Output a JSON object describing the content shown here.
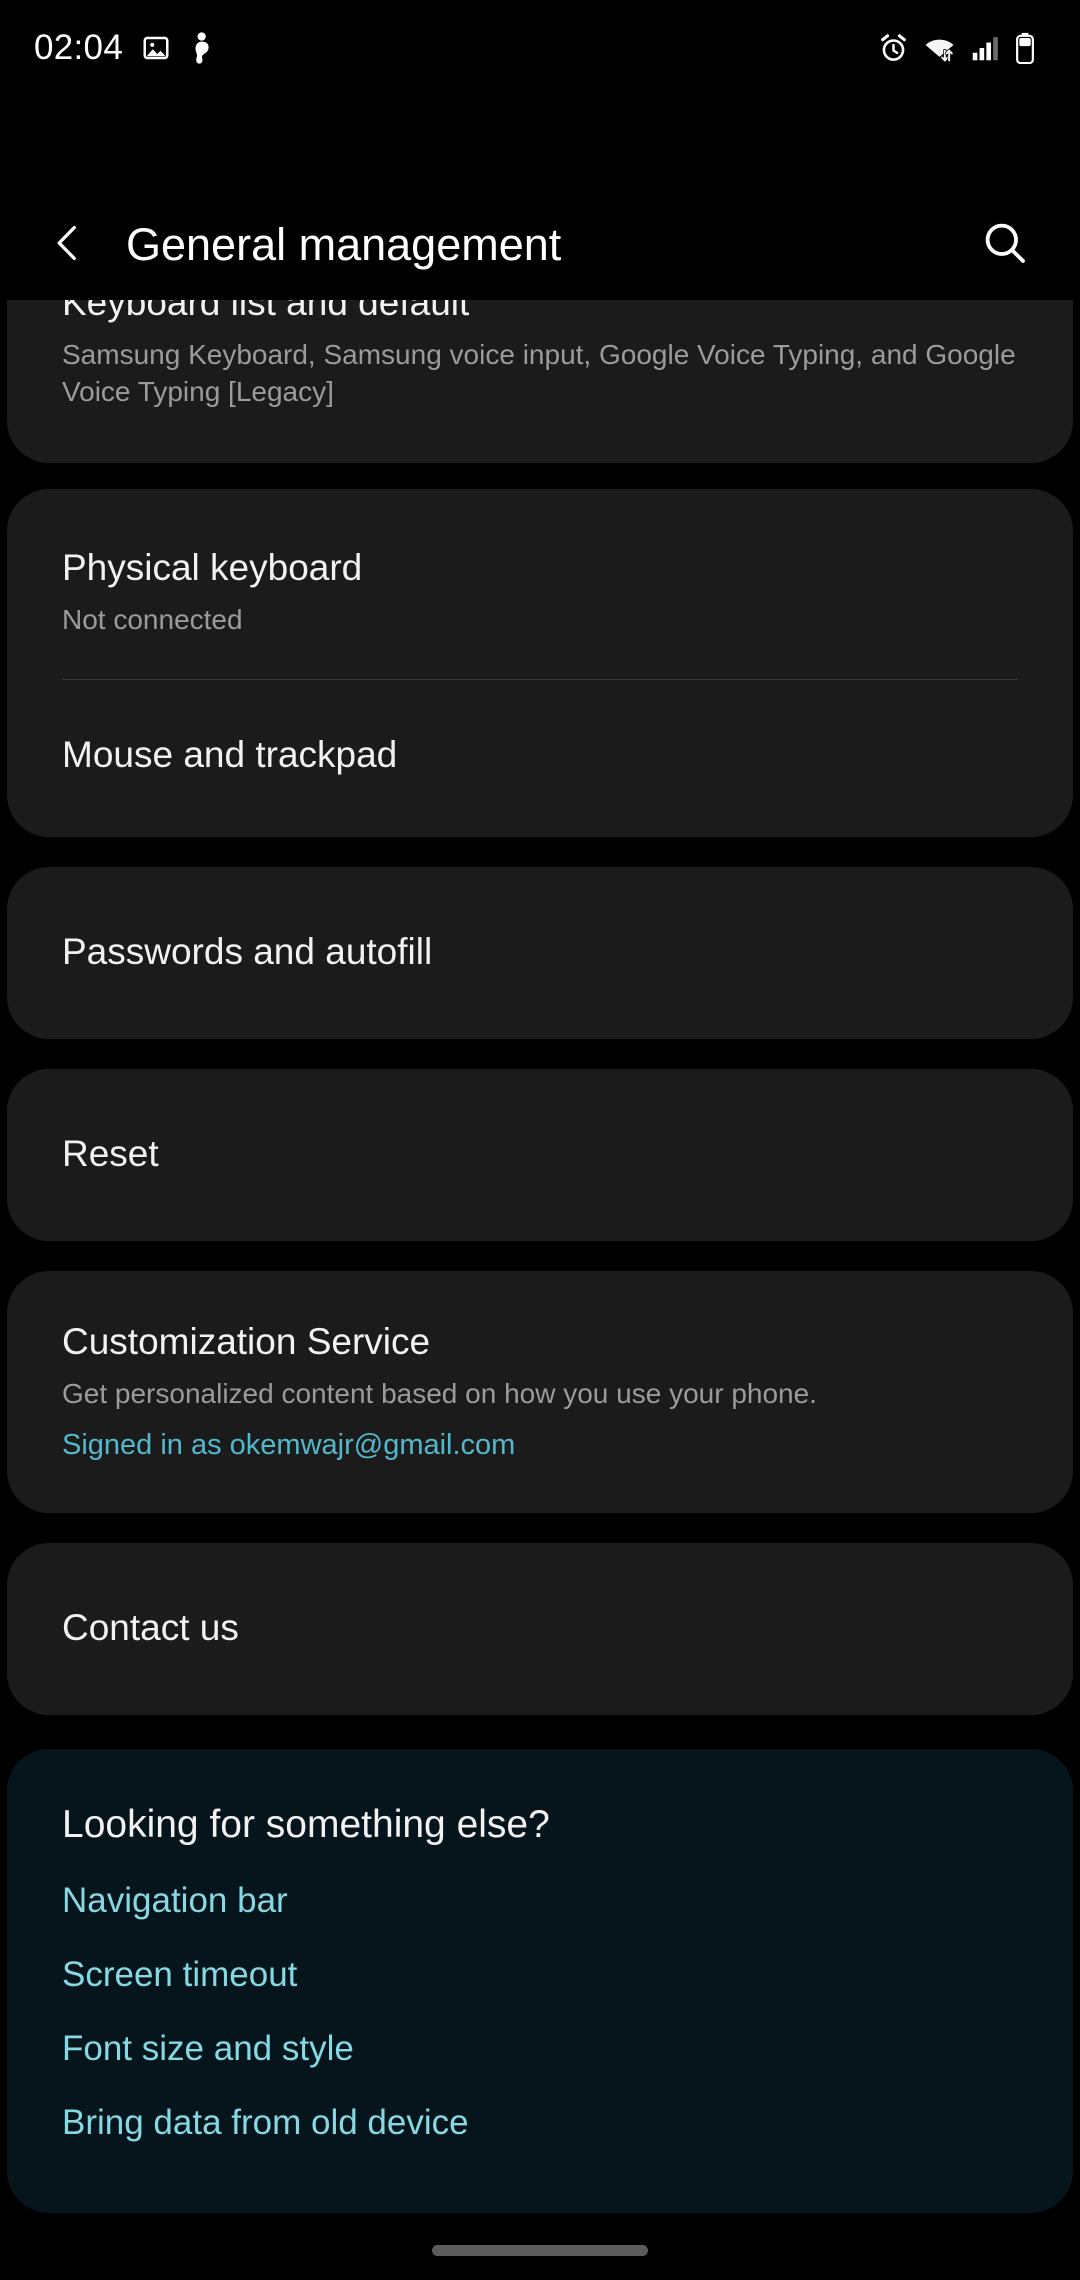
{
  "status_bar": {
    "clock": "02:04",
    "left_icons": [
      "image-icon",
      "pregnancy-tracker-icon"
    ],
    "right_icons": [
      "alarm-icon",
      "wifi-icon",
      "cellular-signal-icon",
      "battery-icon"
    ]
  },
  "app_bar": {
    "back_icon": "back-chevron-icon",
    "title": "General management",
    "search_icon": "search-icon"
  },
  "sections": {
    "keyboard_card": {
      "title": "Keyboard list and default",
      "subtitle": "Samsung Keyboard, Samsung voice input, Google Voice Typing, and Google Voice Typing [Legacy]"
    },
    "input_card": {
      "physical_keyboard_title": "Physical keyboard",
      "physical_keyboard_status": "Not connected",
      "mouse_trackpad_title": "Mouse and trackpad"
    },
    "passwords_card": {
      "title": "Passwords and autofill"
    },
    "reset_card": {
      "title": "Reset"
    },
    "customization_card": {
      "title": "Customization Service",
      "subtitle": "Get personalized content based on how you use your phone.",
      "account_link": "Signed in as okemwajr@gmail.com"
    },
    "contact_card": {
      "title": "Contact us"
    },
    "looking_for_card": {
      "title": "Looking for something else?",
      "links": [
        "Navigation bar",
        "Screen timeout",
        "Font size and style",
        "Bring data from old device"
      ]
    }
  },
  "navigation": {
    "gesture_bar": "gesture-handle"
  },
  "colors": {
    "background": "#000000",
    "card": "#1b1b1b",
    "card_teal": "#06151b",
    "text_primary": "#f2f2f2",
    "text_secondary": "#9b9b9b",
    "link": "#54b8cc",
    "link_bright": "#86d8e3"
  }
}
